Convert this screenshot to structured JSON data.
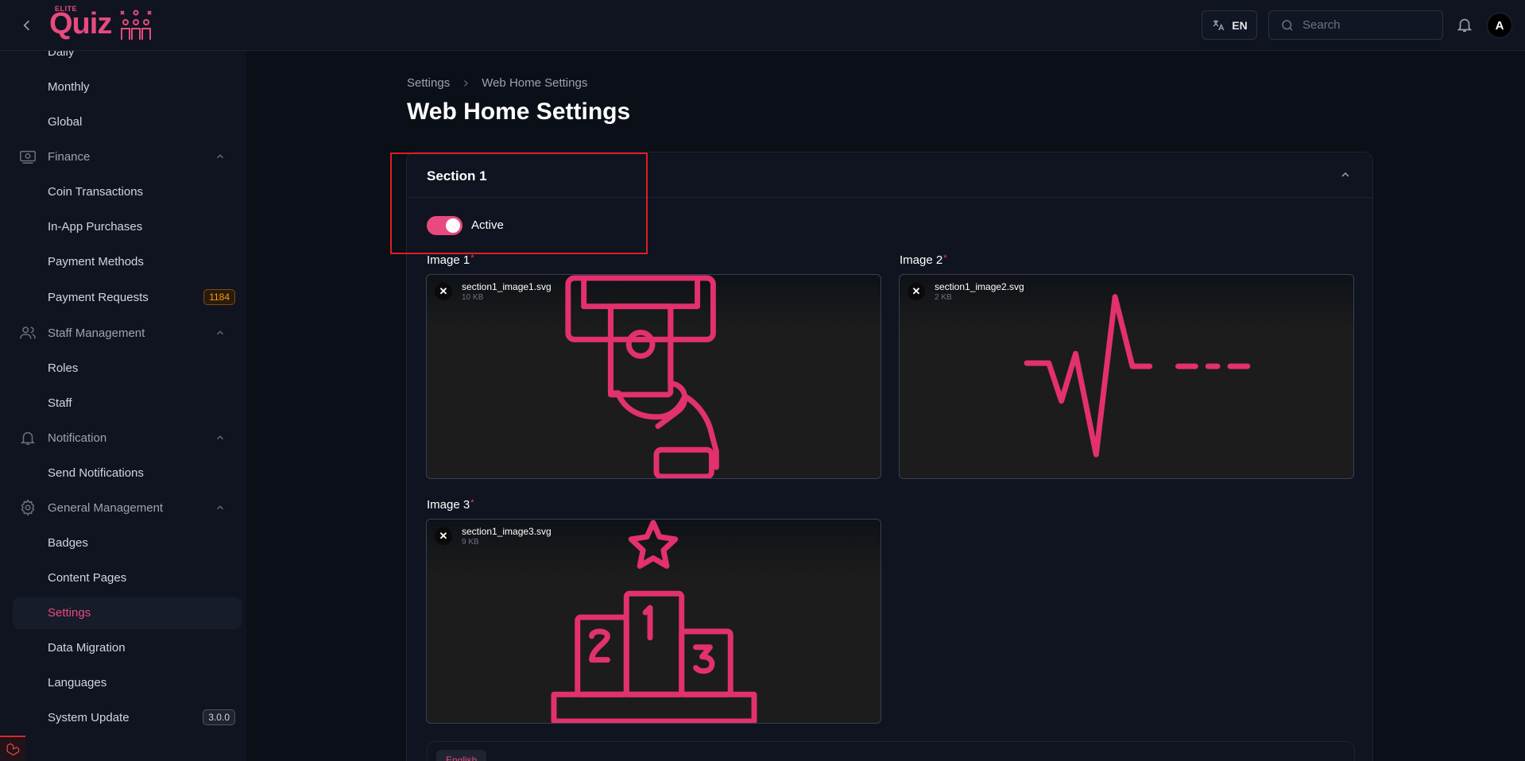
{
  "topbar": {
    "brand_top": "ELITE",
    "brand_main": "Quiz",
    "lang_label": "EN",
    "search_placeholder": "Search",
    "avatar_initial": "A"
  },
  "sidebar": {
    "items_top": [
      "Daily",
      "Monthly",
      "Global"
    ],
    "finance": {
      "label": "Finance",
      "items": [
        "Coin Transactions",
        "In-App Purchases",
        "Payment Methods",
        "Payment Requests"
      ],
      "badge": "1184"
    },
    "staff": {
      "label": "Staff Management",
      "items": [
        "Roles",
        "Staff"
      ]
    },
    "notification": {
      "label": "Notification",
      "items": [
        "Send Notifications"
      ]
    },
    "general": {
      "label": "General Management",
      "items": [
        "Badges",
        "Content Pages",
        "Settings",
        "Data Migration",
        "Languages",
        "System Update"
      ],
      "version": "3.0.0",
      "active": "Settings"
    }
  },
  "breadcrumb": {
    "parent": "Settings",
    "current": "Web Home Settings"
  },
  "page_title": "Web Home Settings",
  "section": {
    "title": "Section 1",
    "toggle_label": "Active",
    "toggle_on": true,
    "images": [
      {
        "label": "Image 1",
        "required": "*",
        "file_name": "section1_image1.svg",
        "file_size": "10 KB",
        "icon": "atm-card-hand-icon"
      },
      {
        "label": "Image 2",
        "required": "*",
        "file_name": "section1_image2.svg",
        "file_size": "2 KB",
        "icon": "heartbeat-icon"
      },
      {
        "label": "Image 3",
        "required": "*",
        "file_name": "section1_image3.svg",
        "file_size": "9 KB",
        "icon": "podium-star-icon"
      }
    ],
    "tab_label": "English"
  },
  "colors": {
    "accent": "#e84a7f",
    "background": "#0b0f17",
    "panel": "#0f1420",
    "highlight": "#e11d24"
  }
}
